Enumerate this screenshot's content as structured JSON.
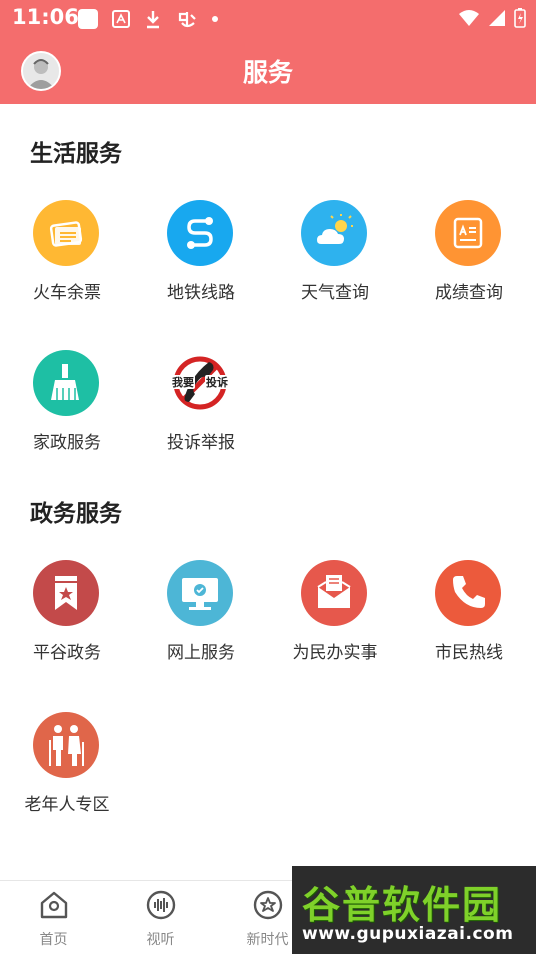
{
  "colors": {
    "brand": "#f46d6d",
    "train": "#ffb833",
    "subway": "#18a8ef",
    "weather": "#2eb2ee",
    "score": "#ff9433",
    "housekeeping": "#1ebfa4",
    "gov": "#c34a4a",
    "online": "#4db6d6",
    "people": "#e6584c",
    "hotline": "#ec5a3c",
    "elderly": "#e0664a"
  },
  "status_bar": {
    "time": "11:06",
    "icons": [
      "square-app-icon",
      "font-app-icon",
      "download-icon",
      "app-icon",
      "dot-icon",
      "wifi-icon",
      "signal-icon",
      "battery-charging-icon"
    ]
  },
  "header": {
    "title": "服务",
    "avatar": "user-avatar"
  },
  "sections": [
    {
      "title": "生活服务",
      "items": [
        {
          "label": "火车余票",
          "icon": "ticket-icon"
        },
        {
          "label": "地铁线路",
          "icon": "route-icon"
        },
        {
          "label": "天气查询",
          "icon": "weather-icon"
        },
        {
          "label": "成绩查询",
          "icon": "report-card-icon"
        },
        {
          "label": "家政服务",
          "icon": "broom-icon"
        },
        {
          "label": "投诉举报",
          "icon": "complaint-phone-icon",
          "badge_left": "我要",
          "badge_right": "投诉"
        }
      ]
    },
    {
      "title": "政务服务",
      "items": [
        {
          "label": "平谷政务",
          "icon": "bookmark-star-icon"
        },
        {
          "label": "网上服务",
          "icon": "monitor-check-icon"
        },
        {
          "label": "为民办实事",
          "icon": "envelope-icon"
        },
        {
          "label": "市民热线",
          "icon": "phone-icon"
        },
        {
          "label": "老年人专区",
          "icon": "elderly-couple-icon"
        }
      ]
    }
  ],
  "tabbar": {
    "items": [
      {
        "label": "首页",
        "icon": "home-icon"
      },
      {
        "label": "视听",
        "icon": "audio-wave-icon"
      },
      {
        "label": "新时代",
        "icon": "star-circle-icon"
      }
    ]
  },
  "watermark": {
    "main": "谷普软件园",
    "sub": "www.gupuxiazai.com"
  }
}
